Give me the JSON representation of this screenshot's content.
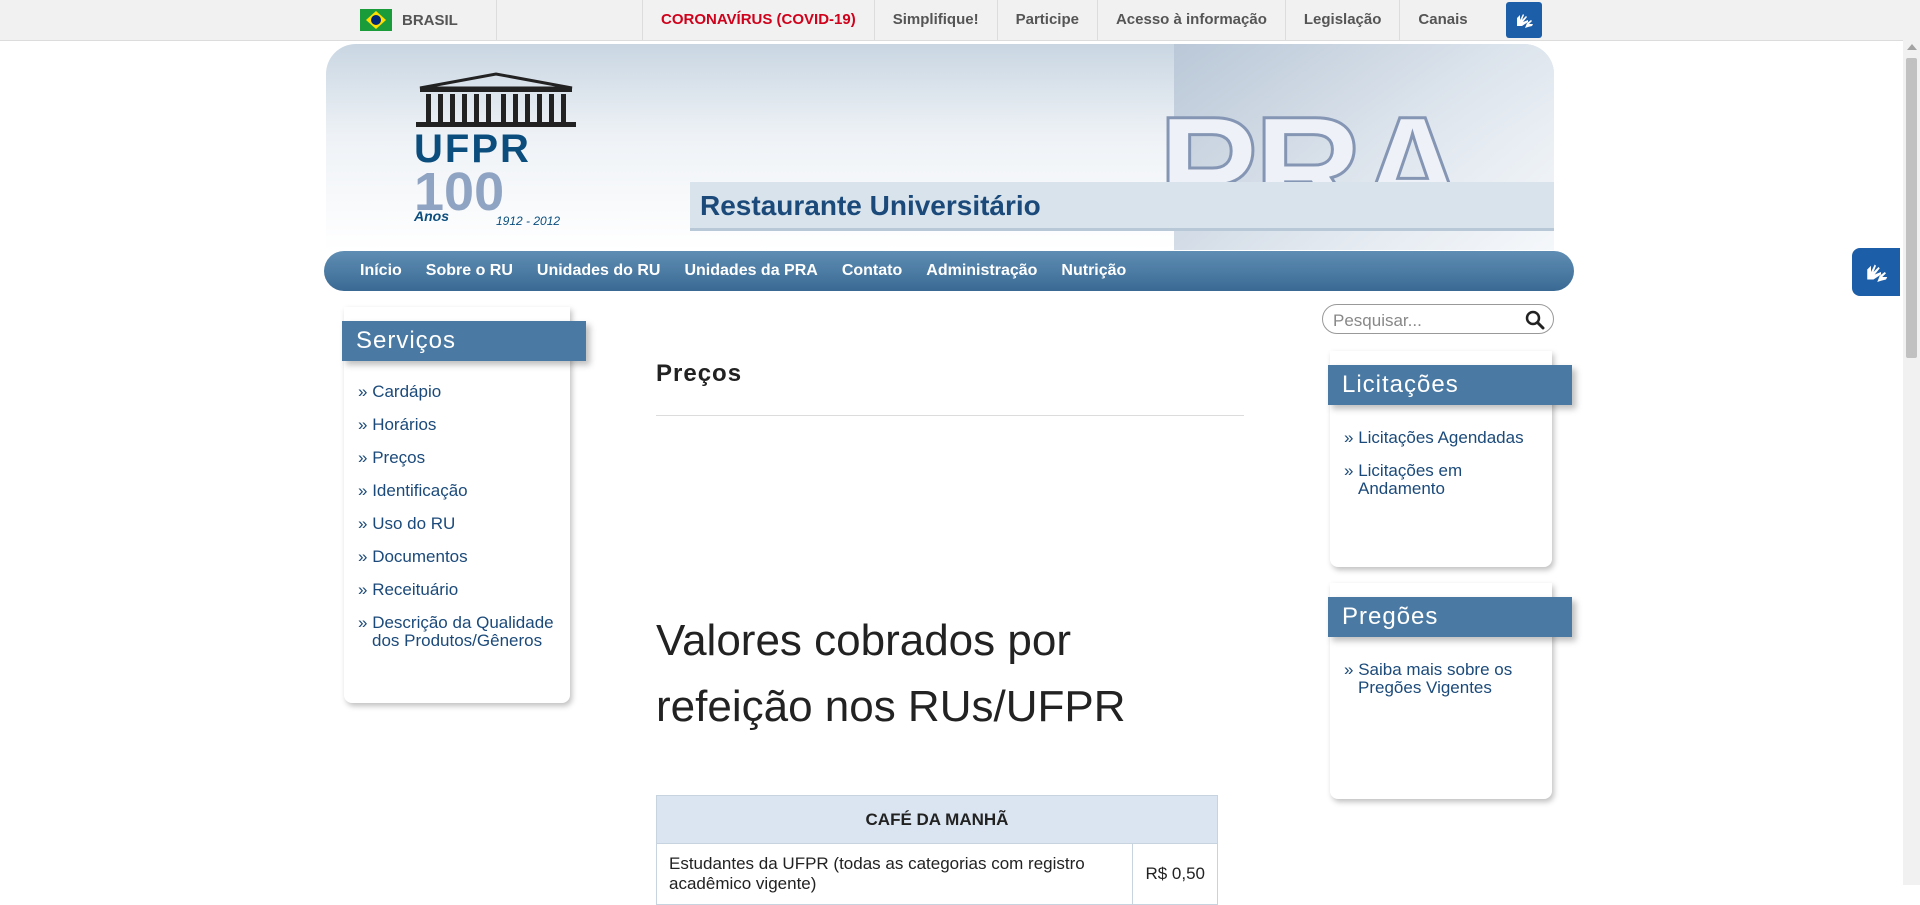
{
  "govbar": {
    "country": "BRASIL",
    "links": [
      "CORONAVÍRUS (COVID-19)",
      "Simplifique!",
      "Participe",
      "Acesso à informação",
      "Legislação",
      "Canais"
    ],
    "accessibility_icon": "hands-sign-language-icon"
  },
  "header": {
    "logo_ufpr": "UFPR",
    "logo_centenary": "100",
    "logo_anos": "Anos",
    "logo_years": "1912 - 2012",
    "banner_text": "PRA",
    "site_title": "Restaurante Universitário"
  },
  "nav": {
    "items": [
      "Início",
      "Sobre o RU",
      "Unidades do RU",
      "Unidades da PRA",
      "Contato",
      "Administração",
      "Nutrição"
    ]
  },
  "sidebar": {
    "title": "Serviços",
    "items": [
      "Cardápio",
      "Horários",
      "Preços",
      "Identificação",
      "Uso do RU",
      "Documentos",
      "Receituário",
      "Descrição da Qualidade dos Produtos/Gêneros"
    ]
  },
  "search": {
    "placeholder": "Pesquisar..."
  },
  "licitacoes": {
    "title": "Licitações",
    "items": [
      "Licitações Agendadas",
      "Licitações em Andamento"
    ]
  },
  "pregoes": {
    "title": "Pregões",
    "items": [
      "Saiba mais sobre os Pregões Vigentes"
    ]
  },
  "main": {
    "page_title": "Preços",
    "heading": "Valores cobrados por refeição nos RUs/UFPR",
    "table": {
      "header": "CAFÉ DA MANHÃ",
      "rows": [
        {
          "label": "Estudantes da UFPR (todas as categorias com registro acadêmico vigente)",
          "price": "R$ 0,50"
        }
      ]
    }
  },
  "colors": {
    "nav_bg": "#3a6a94",
    "panel_header": "#4a7aa3",
    "link": "#1b4a7a",
    "covid": "#d0011b",
    "table_header": "#dbe5f1"
  }
}
